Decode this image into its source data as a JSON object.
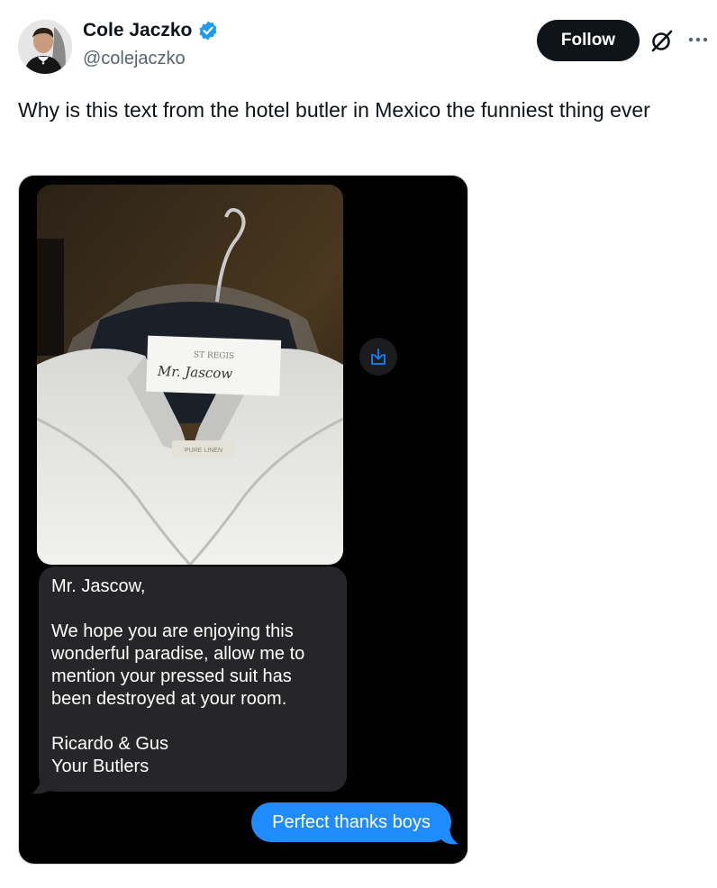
{
  "author": {
    "name": "Cole Jaczko",
    "handle": "@colejaczko",
    "verified": true,
    "verified_color": "#1d9bf0"
  },
  "actions": {
    "follow_label": "Follow",
    "grok_icon": "grok-icon",
    "more_icon": "more-icon"
  },
  "tweet": {
    "text": "Why is this text from the hotel butler in Mexico the funniest thing ever"
  },
  "media": {
    "photo": {
      "tag_brand": "ST REGIS",
      "tag_name": "Mr. Jascow",
      "label_text": "PURE LINEN"
    },
    "messages": {
      "incoming": {
        "greeting": "Mr. Jascow,",
        "body": "We hope you are enjoying this wonderful paradise, allow me to mention your pressed suit has been destroyed at your room.",
        "sign_line1": "Ricardo & Gus",
        "sign_line2": "Your Butlers"
      },
      "outgoing": {
        "text": "Perfect thanks boys",
        "color": "#1f8bfd"
      }
    }
  }
}
